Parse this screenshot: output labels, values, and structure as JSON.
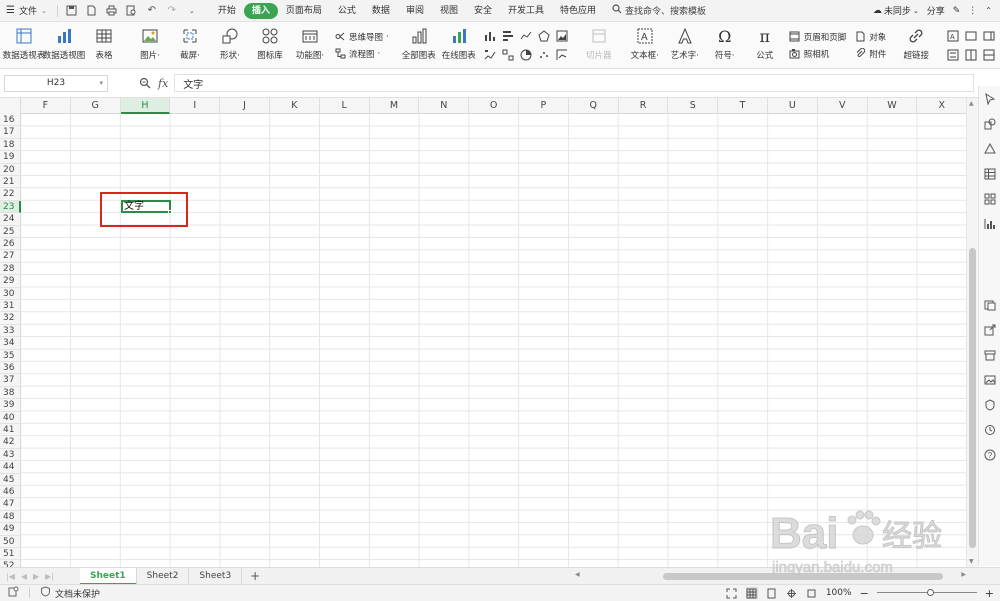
{
  "menubar": {
    "file_label": "文件",
    "tabs": [
      {
        "label": "开始"
      },
      {
        "label": "插入",
        "active": true
      },
      {
        "label": "页面布局"
      },
      {
        "label": "公式"
      },
      {
        "label": "数据"
      },
      {
        "label": "审阅"
      },
      {
        "label": "视图"
      },
      {
        "label": "安全"
      },
      {
        "label": "开发工具"
      },
      {
        "label": "特色应用"
      }
    ],
    "search_label": "查找命令、搜索模板",
    "sync_label": "未同步",
    "share_label": "分享"
  },
  "ribbon": {
    "pivot_table": "数据透视表",
    "pivot_chart": "数据透视图",
    "table": "表格",
    "picture": "图片",
    "screenshot": "截屏",
    "shapes": "形状",
    "icon_library": "图标库",
    "function_chart": "功能图",
    "mind_map": "思维导图",
    "flowchart": "流程图",
    "all_charts": "全部图表",
    "online_charts": "在线图表",
    "slicer": "切片器",
    "textbox": "文本框",
    "wordart": "艺术字",
    "symbol": "符号",
    "formula": "公式",
    "header_footer": "页眉和页脚",
    "object": "对象",
    "camera": "照相机",
    "attachment": "附件",
    "hyperlink": "超链接"
  },
  "formula_bar": {
    "name_box": "H23",
    "fx": "fx",
    "content": "文字"
  },
  "grid": {
    "columns": [
      "F",
      "G",
      "H",
      "I",
      "J",
      "K",
      "L",
      "M",
      "N",
      "O",
      "P",
      "Q",
      "R",
      "S",
      "T",
      "U",
      "V",
      "W",
      "X"
    ],
    "selected_column": "H",
    "rows": [
      "16",
      "17",
      "18",
      "19",
      "20",
      "21",
      "22",
      "23",
      "24",
      "25",
      "26",
      "27",
      "28",
      "29",
      "30",
      "31",
      "32",
      "33",
      "34",
      "35",
      "36",
      "37",
      "38",
      "39",
      "40",
      "41",
      "42",
      "43",
      "44",
      "45",
      "46",
      "47",
      "48",
      "49",
      "50",
      "51",
      "52"
    ],
    "selected_row": "23",
    "selected_cell_value": "文字"
  },
  "sheets": {
    "tabs": [
      "Sheet1",
      "Sheet2",
      "Sheet3"
    ],
    "active": "Sheet1",
    "add_label": "+"
  },
  "status": {
    "protect_label": "文档未保护",
    "zoom": "100%",
    "minus": "−",
    "plus": "+"
  },
  "watermark": {
    "logo_text": "Bai",
    "logo_text2": "经验",
    "url": "jingyan.baidu.com"
  },
  "colors": {
    "accent_green": "#3aa453",
    "selection_green": "#2e8b45",
    "highlight_red": "#d9251c"
  }
}
